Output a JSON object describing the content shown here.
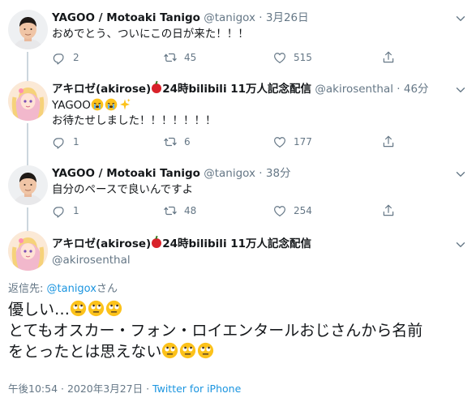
{
  "tweets": [
    {
      "name": "YAGOO / Motoaki Tanigo",
      "handle": "@tanigox",
      "time": "3月26日",
      "text": "おめでとう、ついにこの日が来た！！！",
      "replies": "2",
      "retweets": "45",
      "likes": "515"
    },
    {
      "name_prefix": "アキロゼ(akirose)",
      "name_suffix": "24時bilibili 11万人記念配信",
      "handle": "@akirosenthal",
      "time": "46分",
      "text_line1": "YAGOO",
      "text_line2": "お待たせしました！！！！！！！",
      "replies": "1",
      "retweets": "6",
      "likes": "177"
    },
    {
      "name": "YAGOO / Motoaki Tanigo",
      "handle": "@tanigox",
      "time": "38分",
      "text": "自分のペースで良いんですよ",
      "replies": "1",
      "retweets": "48",
      "likes": "254"
    }
  ],
  "main": {
    "name_prefix": "アキロゼ(akirose)",
    "name_suffix": "24時bilibili 11万人記念配信",
    "handle": "@akirosenthal",
    "reply_label": "返信先: ",
    "reply_handle": "@tanigox",
    "reply_suffix": "さん",
    "line1": "優しい…",
    "line2": "とてもオスカー・フォン・ロイエンタールおじさんから名前",
    "line3": "をとったとは思えない",
    "timestamp": "午後10:54 · 2020年3月27日 · ",
    "source": "Twitter for iPhone"
  },
  "colors": {
    "accent": "#1b95e0",
    "muted": "#657786",
    "apple": "#d8222a"
  },
  "icons": [
    "reply-icon",
    "retweet-icon",
    "like-icon",
    "share-icon",
    "caret-down-icon",
    "apple-emoji",
    "crying-emoji",
    "sparkles-emoji",
    "rolling-eyes-emoji"
  ]
}
